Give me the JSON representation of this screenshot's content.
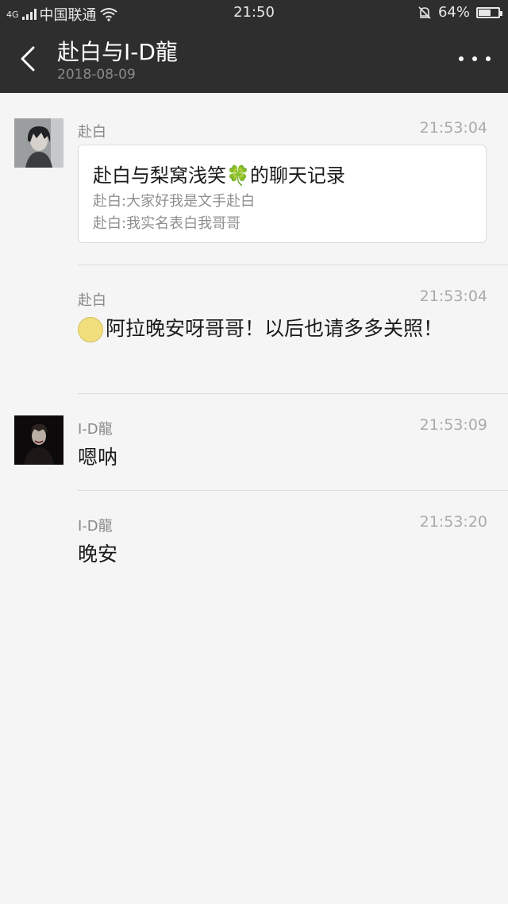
{
  "status_bar": {
    "network": "4G",
    "carrier": "中国联通",
    "time": "21:50",
    "battery": "64%",
    "battery_level": 0.64
  },
  "header": {
    "title": "赴白与I-D龍",
    "date": "2018-08-09"
  },
  "messages": [
    {
      "sender": "赴白",
      "time": "21:53:04",
      "card": {
        "title": "赴白与梨窝浅笑🍀的聊天记录",
        "lines": [
          "赴白:大家好我是文手赴白",
          "赴白:我实名表白我哥哥"
        ]
      }
    },
    {
      "sender": "赴白",
      "time": "21:53:04",
      "text": "阿拉晚安呀哥哥！以后也请多多关照！"
    },
    {
      "sender": "I-D龍",
      "time": "21:53:09",
      "text": "嗯呐"
    },
    {
      "sender": "I-D龍",
      "time": "21:53:20",
      "text": "晚安"
    }
  ],
  "icons": {
    "back": "chevron-left-icon",
    "more": "more-dots-icon",
    "wifi": "wifi-icon",
    "mute": "bell-off-icon",
    "emoji": "moon-face-emoji-icon"
  }
}
